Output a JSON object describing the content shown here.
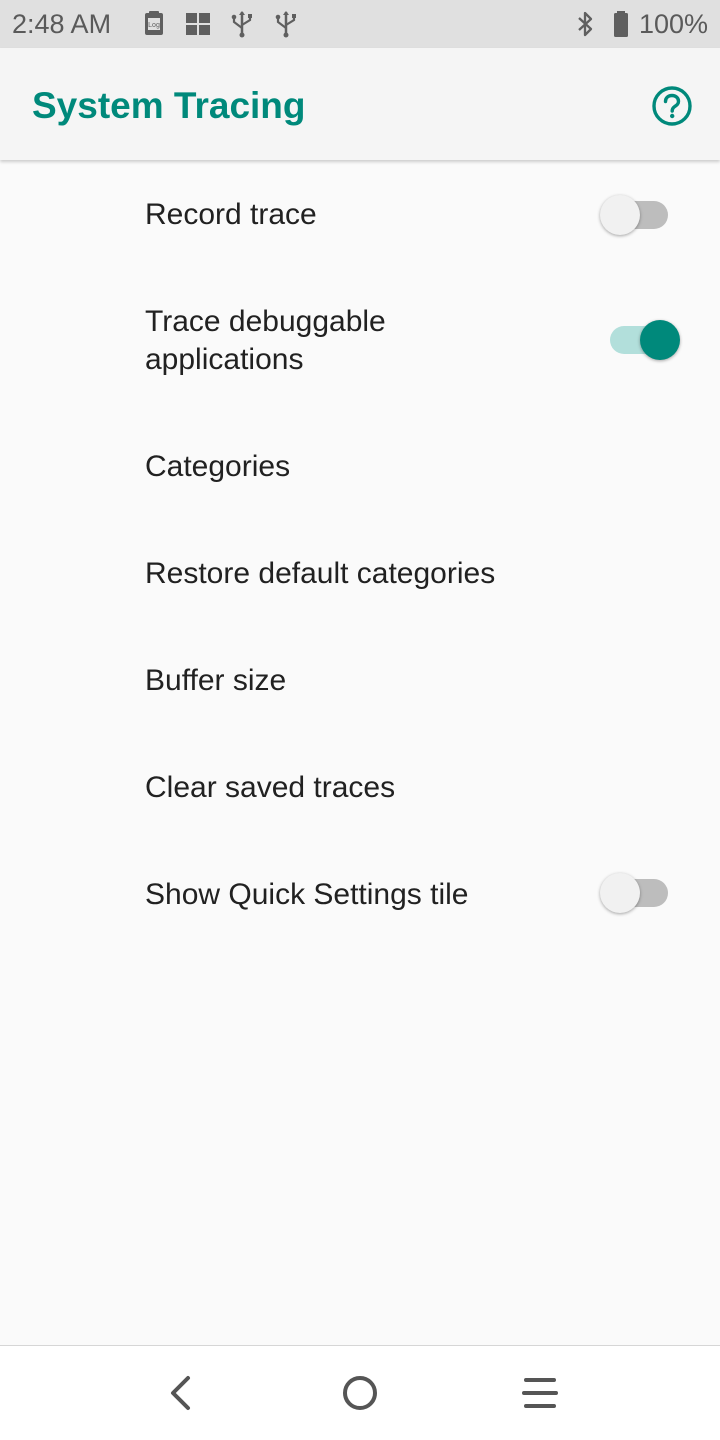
{
  "status_bar": {
    "time": "2:48 AM",
    "battery_text": "100%",
    "icons": [
      "log-notification-icon",
      "grid-app-icon",
      "usb-icon",
      "usb-icon",
      "bluetooth-icon",
      "battery-icon"
    ]
  },
  "app_bar": {
    "title": "System Tracing",
    "help_icon": "help-circle-icon"
  },
  "preferences": [
    {
      "label": "Record trace",
      "has_switch": true,
      "switch_on": false
    },
    {
      "label": "Trace debuggable\napplications",
      "has_switch": true,
      "switch_on": true
    },
    {
      "label": "Categories",
      "has_switch": false
    },
    {
      "label": "Restore default categories",
      "has_switch": false
    },
    {
      "label": "Buffer size",
      "has_switch": false
    },
    {
      "label": "Clear saved traces",
      "has_switch": false
    },
    {
      "label": "Show Quick Settings tile",
      "has_switch": true,
      "switch_on": false
    }
  ],
  "nav_bar": {
    "back_icon": "back-icon",
    "home_icon": "home-icon",
    "menu_icon": "menu-icon"
  },
  "colors": {
    "accent": "#00897b",
    "accent_light": "#b2dfdb",
    "text_primary": "#212121",
    "background": "#fafafa",
    "status_bar": "#e0e0e0"
  }
}
